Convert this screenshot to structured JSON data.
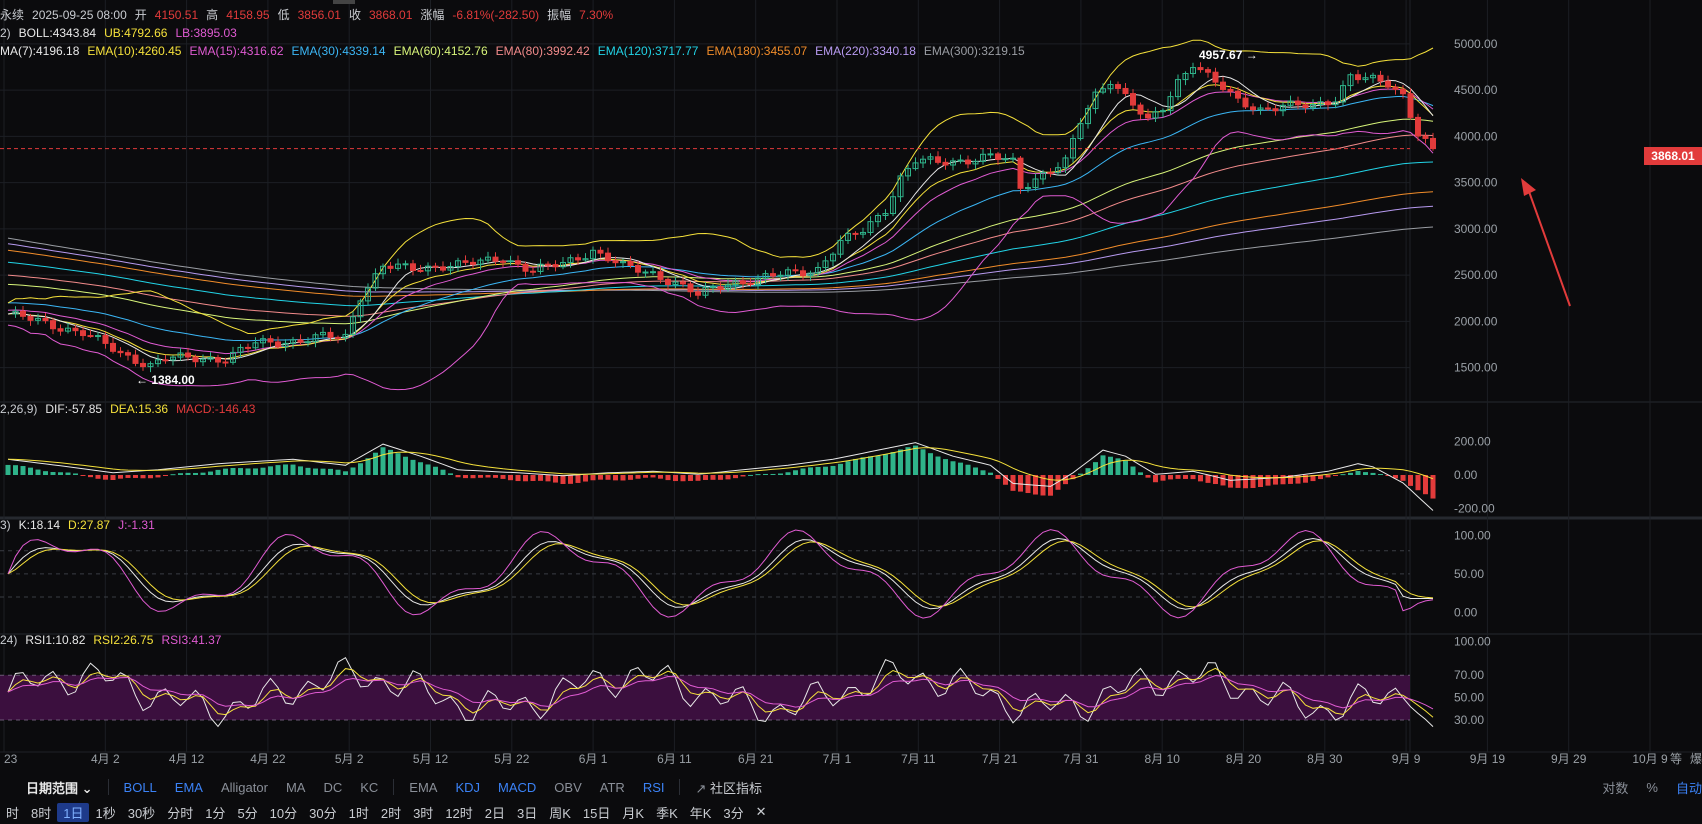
{
  "header": {
    "symbol_tail": "永续",
    "datetime": "2025-09-25 08:00",
    "open_label": "开",
    "open": "4150.51",
    "high_label": "高",
    "high": "4158.95",
    "low_label": "低",
    "low": "3856.01",
    "close_label": "收",
    "close": "3868.01",
    "change_label": "涨幅",
    "change": "-6.81%(-282.50)",
    "amplitude_label": "振幅",
    "amplitude": "7.30%"
  },
  "boll": {
    "params": "2)",
    "mid": "BOLL:4343.84",
    "ub": "UB:4792.66",
    "lb": "LB:3895.03"
  },
  "ema_legend": [
    {
      "text": "MA(7):4196.18",
      "color": "#e8e8e8"
    },
    {
      "text": "EMA(10):4260.45",
      "color": "#f5e13b"
    },
    {
      "text": "EMA(15):4316.62",
      "color": "#e05bd2"
    },
    {
      "text": "EMA(30):4339.14",
      "color": "#3bb6f5"
    },
    {
      "text": "EMA(60):4152.76",
      "color": "#d8f57a"
    },
    {
      "text": "EMA(80):3992.42",
      "color": "#f28b8b"
    },
    {
      "text": "EMA(120):3717.77",
      "color": "#22d3e6"
    },
    {
      "text": "EMA(180):3455.07",
      "color": "#f08c2a"
    },
    {
      "text": "EMA(220):3340.18",
      "color": "#b79af0"
    },
    {
      "text": "EMA(300):3219.15",
      "color": "#9a9da3"
    }
  ],
  "macd": {
    "params": "2,26,9)",
    "dif": "DIF:-57.85",
    "dea": "DEA:15.36",
    "macd": "MACD:-146.43"
  },
  "kdj": {
    "params": "3)",
    "k": "K:18.14",
    "d": "D:27.87",
    "j": "J:-1.31"
  },
  "rsi": {
    "params": "24)",
    "rsi1": "RSI1:10.82",
    "rsi2": "RSI2:26.75",
    "rsi3": "RSI3:41.37"
  },
  "last_price": "3868.01",
  "annotations": {
    "high": "4957.67",
    "low": "1384.00"
  },
  "toolbar1": {
    "date_range": "日期范围",
    "main_indicators": [
      "BOLL",
      "EMA",
      "Alligator",
      "MA",
      "DC",
      "KC"
    ],
    "main_active": [
      "BOLL",
      "EMA"
    ],
    "sub_indicators": [
      "EMA",
      "KDJ",
      "MACD",
      "OBV",
      "ATR",
      "RSI"
    ],
    "sub_active": [
      "KDJ",
      "MACD",
      "RSI"
    ],
    "community": "社区指标",
    "right": [
      "对数",
      "%",
      "自动"
    ]
  },
  "toolbar2": {
    "intervals": [
      "时",
      "8时",
      "1日",
      "1秒",
      "30秒",
      "分时",
      "1分",
      "5分",
      "10分",
      "30分",
      "1时",
      "2时",
      "3时",
      "12时",
      "2日",
      "3日",
      "周K",
      "15日",
      "月K",
      "季K",
      "年K",
      "3分"
    ],
    "active": "1日",
    "close_symbol": "✕"
  },
  "colors": {
    "up": "#2fb38a",
    "down": "#e23b3b",
    "bg": "#0b0b0d",
    "grid": "#1c1f24",
    "text": "#c9ccd1"
  },
  "chart_data": {
    "type": "candlestick",
    "x_ticks": [
      "23",
      "4月 2",
      "4月 12",
      "4月 22",
      "5月 2",
      "5月 12",
      "5月 22",
      "6月 1",
      "6月 11",
      "6月 21",
      "7月 1",
      "7月 11",
      "7月 21",
      "7月 31",
      "8月 10",
      "8月 20",
      "8月 30",
      "9月 9",
      "9月 19",
      "9月 29",
      "10月 9"
    ],
    "price_axis": {
      "ticks": [
        5000,
        4500,
        4000,
        3500,
        3000,
        2500,
        2000,
        1500
      ],
      "labels": [
        "5000.00",
        "4500.00",
        "4000.00",
        "3500.00",
        "3000.00",
        "2500.00",
        "2000.00",
        "1500.00"
      ],
      "ylim": [
        1150,
        5280
      ]
    },
    "price_series": [
      {
        "x": 0,
        "y": 2080
      },
      {
        "x": 5,
        "y": 1980
      },
      {
        "x": 10,
        "y": 1880
      },
      {
        "x": 15,
        "y": 1650
      },
      {
        "x": 19,
        "y": 1530
      },
      {
        "x": 21,
        "y": 1600
      },
      {
        "x": 25,
        "y": 1600
      },
      {
        "x": 29,
        "y": 1600
      },
      {
        "x": 33,
        "y": 1760
      },
      {
        "x": 38,
        "y": 1790
      },
      {
        "x": 42,
        "y": 1830
      },
      {
        "x": 45,
        "y": 1830
      },
      {
        "x": 47,
        "y": 2280
      },
      {
        "x": 50,
        "y": 2600
      },
      {
        "x": 54,
        "y": 2560
      },
      {
        "x": 58,
        "y": 2610
      },
      {
        "x": 63,
        "y": 2630
      },
      {
        "x": 66,
        "y": 2690
      },
      {
        "x": 70,
        "y": 2550
      },
      {
        "x": 74,
        "y": 2620
      },
      {
        "x": 78,
        "y": 2770
      },
      {
        "x": 82,
        "y": 2590
      },
      {
        "x": 86,
        "y": 2520
      },
      {
        "x": 89,
        "y": 2420
      },
      {
        "x": 92,
        "y": 2280
      },
      {
        "x": 96,
        "y": 2420
      },
      {
        "x": 100,
        "y": 2450
      },
      {
        "x": 104,
        "y": 2520
      },
      {
        "x": 108,
        "y": 2570
      },
      {
        "x": 111,
        "y": 2850
      },
      {
        "x": 114,
        "y": 2980
      },
      {
        "x": 117,
        "y": 3220
      },
      {
        "x": 119,
        "y": 3550
      },
      {
        "x": 121,
        "y": 3730
      },
      {
        "x": 124,
        "y": 3720
      },
      {
        "x": 128,
        "y": 3750
      },
      {
        "x": 131,
        "y": 3780
      },
      {
        "x": 134,
        "y": 3720
      },
      {
        "x": 135,
        "y": 3450
      },
      {
        "x": 138,
        "y": 3600
      },
      {
        "x": 141,
        "y": 3720
      },
      {
        "x": 143,
        "y": 4150
      },
      {
        "x": 145,
        "y": 4450
      },
      {
        "x": 147,
        "y": 4620
      },
      {
        "x": 150,
        "y": 4350
      },
      {
        "x": 152,
        "y": 4150
      },
      {
        "x": 154,
        "y": 4300
      },
      {
        "x": 156,
        "y": 4600
      },
      {
        "x": 158,
        "y": 4800
      },
      {
        "x": 161,
        "y": 4580
      },
      {
        "x": 164,
        "y": 4380
      },
      {
        "x": 167,
        "y": 4300
      },
      {
        "x": 170,
        "y": 4330
      },
      {
        "x": 174,
        "y": 4320
      },
      {
        "x": 177,
        "y": 4420
      },
      {
        "x": 179,
        "y": 4660
      },
      {
        "x": 182,
        "y": 4600
      },
      {
        "x": 184,
        "y": 4560
      },
      {
        "x": 186,
        "y": 4450
      },
      {
        "x": 188,
        "y": 4050
      },
      {
        "x": 190,
        "y": 3868
      }
    ],
    "macd_axis": {
      "ticks": [
        200,
        0,
        -200
      ],
      "labels": [
        "200.00",
        "0.00",
        "-200.00"
      ]
    },
    "macd_hist": [
      {
        "x": 0,
        "y": 60
      },
      {
        "x": 8,
        "y": 10
      },
      {
        "x": 14,
        "y": -30
      },
      {
        "x": 20,
        "y": -10
      },
      {
        "x": 28,
        "y": 30
      },
      {
        "x": 38,
        "y": 60
      },
      {
        "x": 45,
        "y": 20
      },
      {
        "x": 50,
        "y": 160
      },
      {
        "x": 55,
        "y": 80
      },
      {
        "x": 60,
        "y": -10
      },
      {
        "x": 68,
        "y": -30
      },
      {
        "x": 74,
        "y": -50
      },
      {
        "x": 80,
        "y": -30
      },
      {
        "x": 86,
        "y": -20
      },
      {
        "x": 92,
        "y": -40
      },
      {
        "x": 98,
        "y": -10
      },
      {
        "x": 104,
        "y": 20
      },
      {
        "x": 110,
        "y": 60
      },
      {
        "x": 116,
        "y": 120
      },
      {
        "x": 121,
        "y": 170
      },
      {
        "x": 126,
        "y": 80
      },
      {
        "x": 131,
        "y": 20
      },
      {
        "x": 134,
        "y": -100
      },
      {
        "x": 139,
        "y": -120
      },
      {
        "x": 142,
        "y": -30
      },
      {
        "x": 146,
        "y": 120
      },
      {
        "x": 149,
        "y": 80
      },
      {
        "x": 153,
        "y": -40
      },
      {
        "x": 158,
        "y": -20
      },
      {
        "x": 163,
        "y": -80
      },
      {
        "x": 170,
        "y": -60
      },
      {
        "x": 176,
        "y": -20
      },
      {
        "x": 180,
        "y": 30
      },
      {
        "x": 186,
        "y": -30
      },
      {
        "x": 190,
        "y": -146
      }
    ],
    "kdj_axis": {
      "ticks": [
        100,
        50,
        0
      ],
      "labels": [
        "100.00",
        "50.00",
        "0.00"
      ],
      "ylim": [
        -15,
        112
      ]
    },
    "rsi_axis": {
      "ticks": [
        100,
        70,
        50,
        30
      ],
      "labels": [
        "100.00",
        "70.00",
        "50.00",
        "30.00"
      ],
      "ylim": [
        5,
        105
      ]
    }
  }
}
